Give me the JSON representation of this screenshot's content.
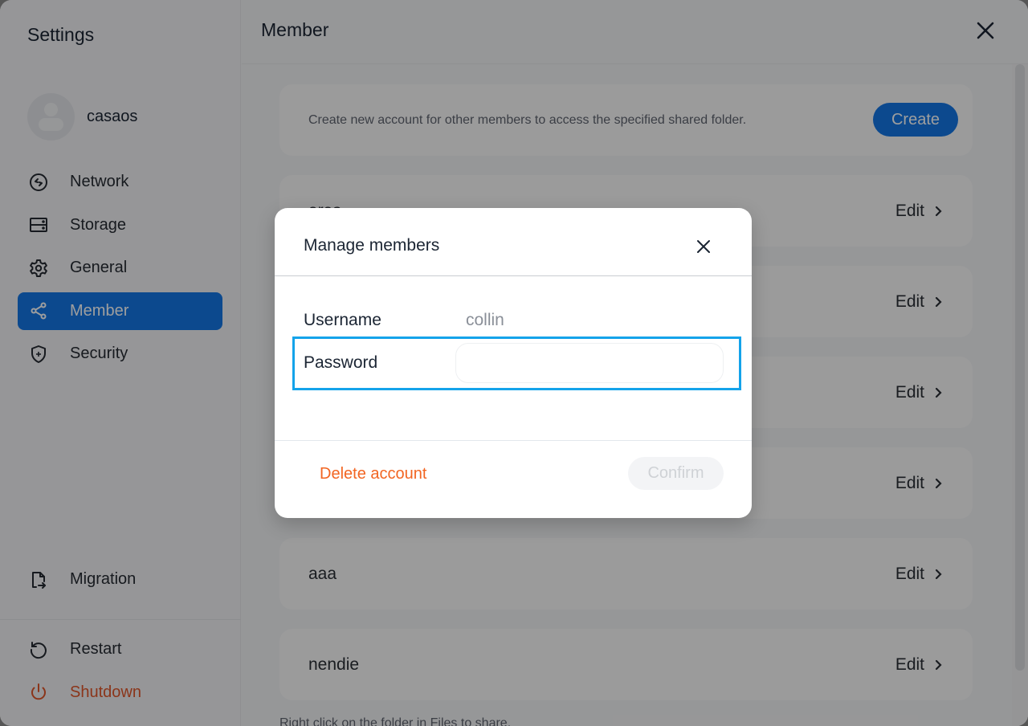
{
  "sidebar": {
    "title": "Settings",
    "user": {
      "name": "casaos",
      "avatar_icon": "user-icon"
    },
    "items": [
      {
        "label": "Network",
        "icon": "network-icon",
        "active": false
      },
      {
        "label": "Storage",
        "icon": "storage-icon",
        "active": false
      },
      {
        "label": "General",
        "icon": "gear-icon",
        "active": false
      },
      {
        "label": "Member",
        "icon": "share-icon",
        "active": true
      },
      {
        "label": "Security",
        "icon": "shield-plus-icon",
        "active": false
      }
    ],
    "bottom_items": [
      {
        "label": "Migration",
        "icon": "file-export-icon"
      }
    ],
    "system_items": [
      {
        "label": "Restart",
        "icon": "restart-icon"
      },
      {
        "label": "Shutdown",
        "icon": "power-icon"
      }
    ]
  },
  "main": {
    "title": "Member",
    "create_card": {
      "description": "Create new account for other members to access the specified shared folder.",
      "button_label": "Create"
    },
    "members": [
      {
        "name": "aras",
        "edit_label": "Edit"
      },
      {
        "name": "",
        "edit_label": "Edit"
      },
      {
        "name": "",
        "edit_label": "Edit"
      },
      {
        "name": "",
        "edit_label": "Edit"
      },
      {
        "name": "aaa",
        "edit_label": "Edit"
      },
      {
        "name": "nendie",
        "edit_label": "Edit"
      }
    ],
    "footnote": "Right click on the folder in Files to share."
  },
  "modal": {
    "title": "Manage members",
    "username_label": "Username",
    "username_value": "collin",
    "password_label": "Password",
    "password_value": "",
    "password_placeholder": "",
    "delete_label": "Delete account",
    "confirm_label": "Confirm"
  },
  "colors": {
    "accent": "#1477e6",
    "danger": "#f26522",
    "focus": "#14a3ea"
  }
}
